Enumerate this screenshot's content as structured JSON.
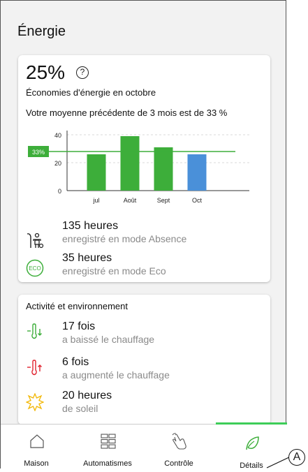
{
  "page": {
    "title": "Énergie"
  },
  "savings": {
    "percent": "25%",
    "help_icon": "?",
    "subtitle": "Économies d'énergie en octobre",
    "average_text": "Votre moyenne précédente de 3 mois est de 33 %"
  },
  "chart_data": {
    "type": "bar",
    "categories": [
      "jul",
      "Août",
      "Sept",
      "Oct"
    ],
    "values": [
      26,
      39,
      31,
      26
    ],
    "colors": [
      "#3dae3a",
      "#3dae3a",
      "#3dae3a",
      "#4a90d9"
    ],
    "ylim": [
      0,
      40
    ],
    "yticks": [
      "0",
      "20",
      "40"
    ],
    "reference_line": {
      "value": 28,
      "label": "33%",
      "color": "#3dae3a"
    },
    "grid": true
  },
  "stats": [
    {
      "icon": "away-mode-icon",
      "value": "135 heures",
      "desc": "enregistré en mode Absence"
    },
    {
      "icon": "eco-icon",
      "value": "35 heures",
      "desc": "enregistré en mode Eco",
      "badge": "ECO"
    }
  ],
  "activity": {
    "title": "Activité et environnement",
    "items": [
      {
        "icon": "thermometer-down-icon",
        "value": "17 fois",
        "desc": "a baissé le chauffage",
        "color": "#3dae3a"
      },
      {
        "icon": "thermometer-up-icon",
        "value": "6 fois",
        "desc": "a augmenté le chauffage",
        "color": "#e0232f"
      },
      {
        "icon": "sun-icon",
        "value": "20 heures",
        "desc": "de soleil",
        "color": "#f2b705"
      }
    ]
  },
  "nav": {
    "tabs": [
      {
        "label": "Maison",
        "icon": "home-icon"
      },
      {
        "label": "Automatismes",
        "icon": "grid-icon"
      },
      {
        "label": "Contrôle",
        "icon": "touch-icon"
      },
      {
        "label": "Détails",
        "icon": "leaf-icon"
      }
    ],
    "active_color": "#3dcd58"
  },
  "callout": {
    "label": "A"
  }
}
